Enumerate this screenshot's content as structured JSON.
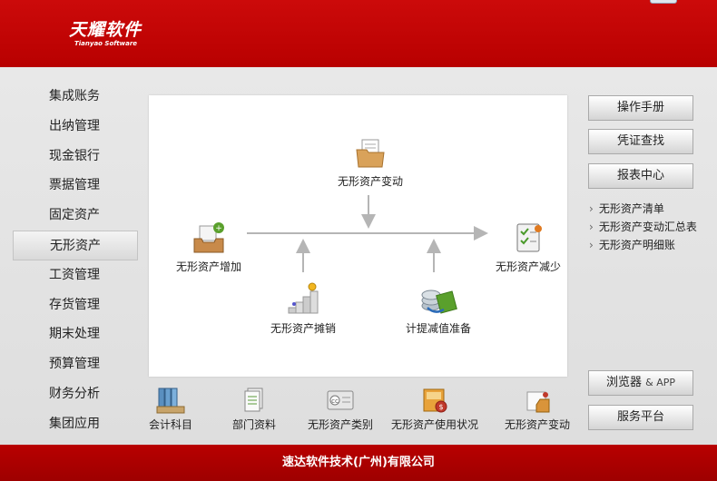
{
  "header": {
    "logo_cn": "天耀软件",
    "logo_en": "Tianyao Software"
  },
  "nav": {
    "items": [
      {
        "label": "集成账务"
      },
      {
        "label": "出纳管理"
      },
      {
        "label": "现金银行"
      },
      {
        "label": "票据管理"
      },
      {
        "label": "固定资产"
      },
      {
        "label": "无形资产",
        "active": true
      },
      {
        "label": "工资管理"
      },
      {
        "label": "存货管理"
      },
      {
        "label": "期末处理"
      },
      {
        "label": "预算管理"
      },
      {
        "label": "财务分析"
      },
      {
        "label": "集团应用"
      }
    ]
  },
  "flow": {
    "change": {
      "label": "无形资产变动",
      "icon": "folder-documents-icon"
    },
    "add": {
      "label": "无形资产增加",
      "icon": "inbox-add-icon"
    },
    "reduce": {
      "label": "无形资产减少",
      "icon": "checklist-icon"
    },
    "amortize": {
      "label": "无形资产摊销",
      "icon": "coin-stairs-icon"
    },
    "impairment": {
      "label": "计提减值准备",
      "icon": "coins-cash-icon"
    }
  },
  "shortcuts": [
    {
      "label": "会计科目",
      "icon": "binders-icon"
    },
    {
      "label": "部门资料",
      "icon": "document-stack-icon"
    },
    {
      "label": "无形资产类别",
      "icon": "category-card-icon"
    },
    {
      "label": "无形资产使用状况",
      "icon": "status-book-icon"
    },
    {
      "label": "无形资产变动",
      "icon": "change-box-icon"
    }
  ],
  "right": {
    "manual": "操作手册",
    "voucher": "凭证查找",
    "report_center": "报表中心",
    "report_links": [
      "无形资产清单",
      "无形资产变动汇总表",
      "无形资产明细账"
    ],
    "browser_app": "浏览器",
    "browser_app_amp": "& APP",
    "service": "服务平台"
  },
  "footer": {
    "company": "速达软件技术(广州)有限公司"
  },
  "colors": {
    "brand_red": "#b80000",
    "arrow_gray": "#b5b5b5"
  }
}
